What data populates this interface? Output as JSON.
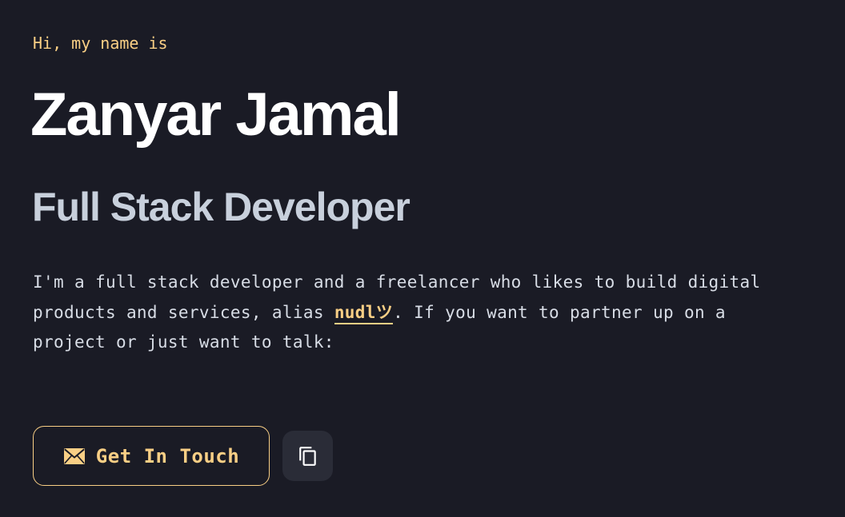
{
  "hero": {
    "greeting": "Hi, my name is",
    "name": "Zanyar Jamal",
    "role": "Full Stack Developer",
    "bio_before": "I'm a full stack developer and a freelancer who likes to build digital products and services, alias ",
    "alias": "nudlツ",
    "bio_after": ". If you want to partner up on a project or just want to talk:"
  },
  "actions": {
    "contact_label": "Get In Touch",
    "contact_icon": "envelope-icon",
    "copy_icon": "copy-icon"
  },
  "colors": {
    "background": "#1a1b25",
    "accent": "#f9cf85",
    "heading": "#ffffff",
    "subheading": "#c8d0dc",
    "body_text": "#d8dde6",
    "secondary_button": "#2a2c37"
  }
}
